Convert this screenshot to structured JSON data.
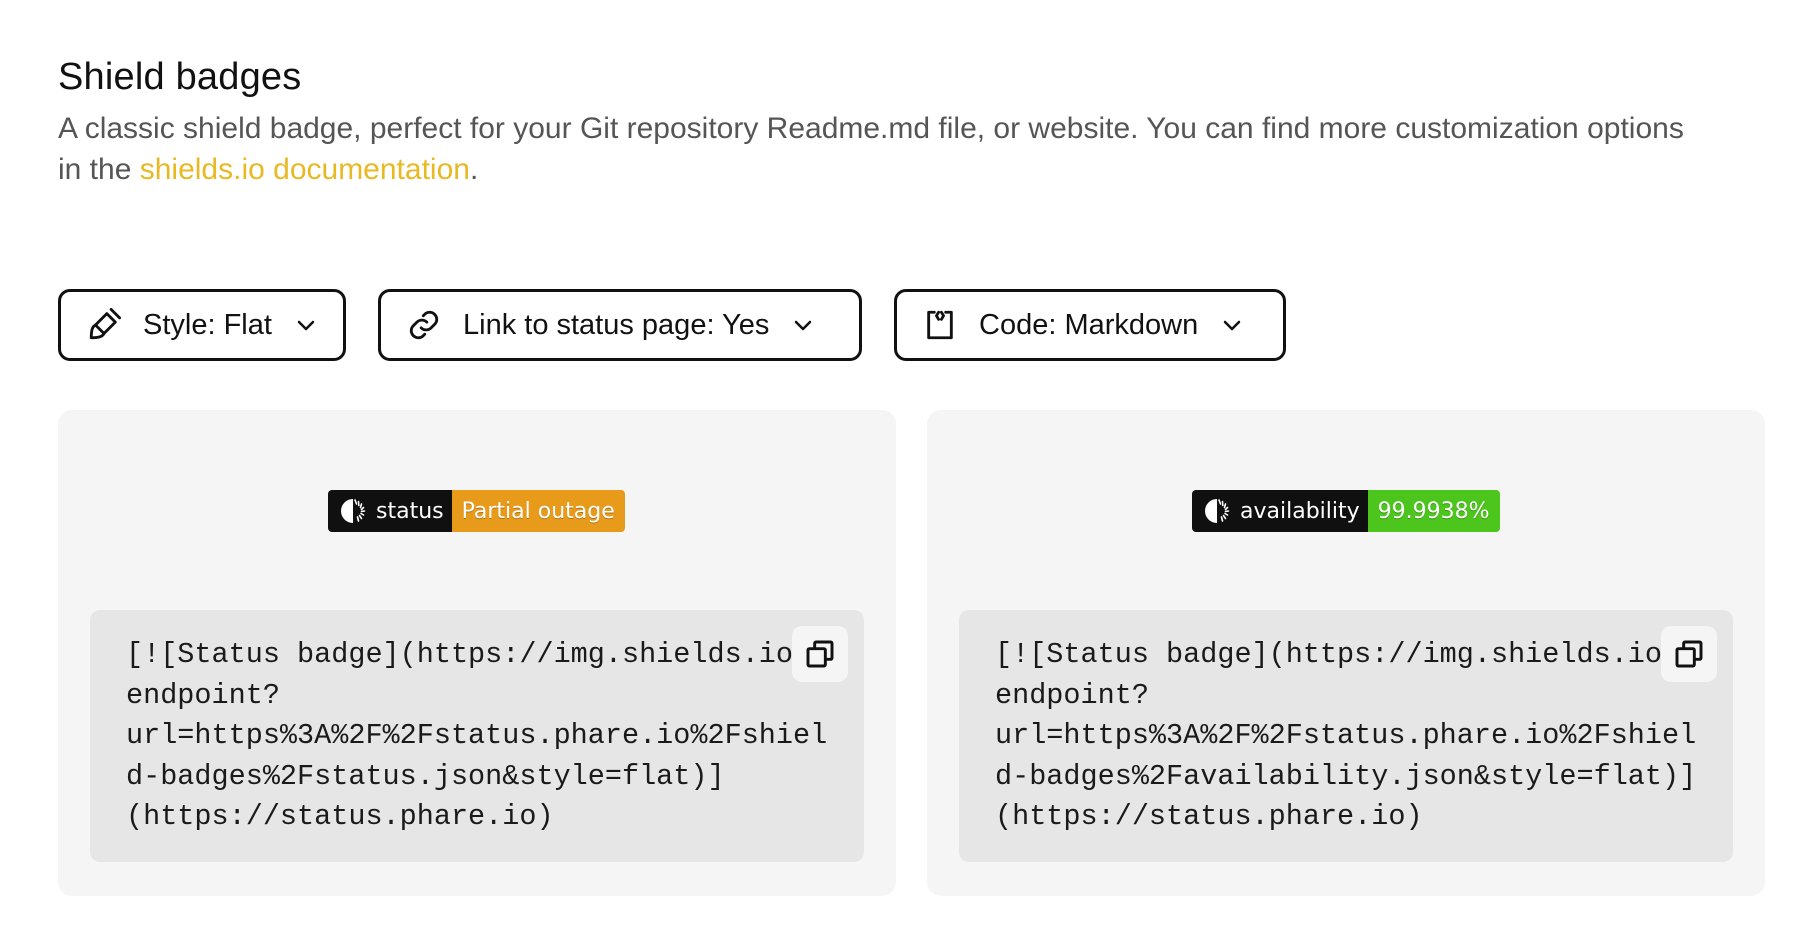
{
  "section": {
    "title": "Shield badges",
    "description_text": "A classic shield badge, perfect for your Git repository Readme.md file, or website. You can find more customization options in the ",
    "doc_link_label": "shields.io documentation",
    "description_end": "."
  },
  "controls": {
    "style": {
      "label": "Style: Flat",
      "icon": "brush-icon"
    },
    "link": {
      "label": "Link to status page: Yes",
      "icon": "link-icon"
    },
    "code": {
      "label": "Code: Markdown",
      "icon": "code-frame-icon"
    }
  },
  "colors": {
    "accent_link": "#e8b923",
    "badge_label_bg": "#101010",
    "badge_status_bg": "#e89a1b",
    "badge_availability_bg": "#4cc51d",
    "panel_bg": "#f5f5f5",
    "code_bg": "#e6e6e6"
  },
  "panels": [
    {
      "badge_label": "status",
      "badge_message": "Partial outage",
      "code_lines": [
        "[![Status badge](https://img.shields.io/",
        "endpoint?",
        "url=https%3A%2F%2Fstatus.phare.io%2Fshiel",
        "d-badges%2Fstatus.json&style=flat)]",
        "(https://status.phare.io)"
      ]
    },
    {
      "badge_label": "availability",
      "badge_message": "99.9938%",
      "code_lines": [
        "[![Status badge](https://img.shields.io/",
        "endpoint?",
        "url=https%3A%2F%2Fstatus.phare.io%2Fshiel",
        "d-badges%2Favailability.json&style=flat)]",
        "(https://status.phare.io)"
      ]
    }
  ]
}
